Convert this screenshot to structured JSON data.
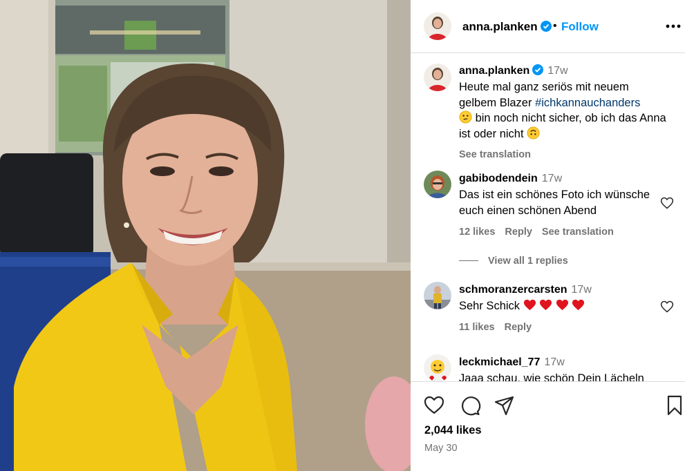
{
  "post": {
    "username": "anna.planken",
    "follow_label": "Follow",
    "separator": "•",
    "caption": {
      "username": "anna.planken",
      "time": "17w",
      "text_start": "Heute mal ganz seriös mit neuem gelbem Blazer ",
      "hashtag": "#ichkannauchanders",
      "text_mid": " bin noch nicht sicher, ob ich das Anna ist oder nicht ",
      "see_translation": "See translation"
    },
    "likes": "2,044 likes",
    "date": "May 30"
  },
  "comments": [
    {
      "username": "gabibodendein",
      "time": "17w",
      "text": "Das ist ein schönes Foto ich wünsche euch einen schönen Abend",
      "likes": "12 likes",
      "reply": "Reply",
      "translate": "See translation",
      "view_replies": "View all 1 replies"
    },
    {
      "username": "schmoranzercarsten",
      "time": "17w",
      "text": "Sehr Schick ",
      "likes": "11 likes",
      "reply": "Reply"
    },
    {
      "username": "leckmichael_77",
      "time": "17w",
      "text": "Jaaa schau, wie schön Dein Lächeln"
    }
  ],
  "icons": {
    "verified": "verified-badge-icon",
    "more": "more-options-icon",
    "like": "heart-icon",
    "comment": "comment-icon",
    "share": "share-icon",
    "save": "bookmark-icon"
  },
  "colors": {
    "follow": "#0095f6",
    "verified": "#0095f6",
    "hashtag": "#00376b",
    "muted": "#737373",
    "blazer": "#f2c816"
  }
}
